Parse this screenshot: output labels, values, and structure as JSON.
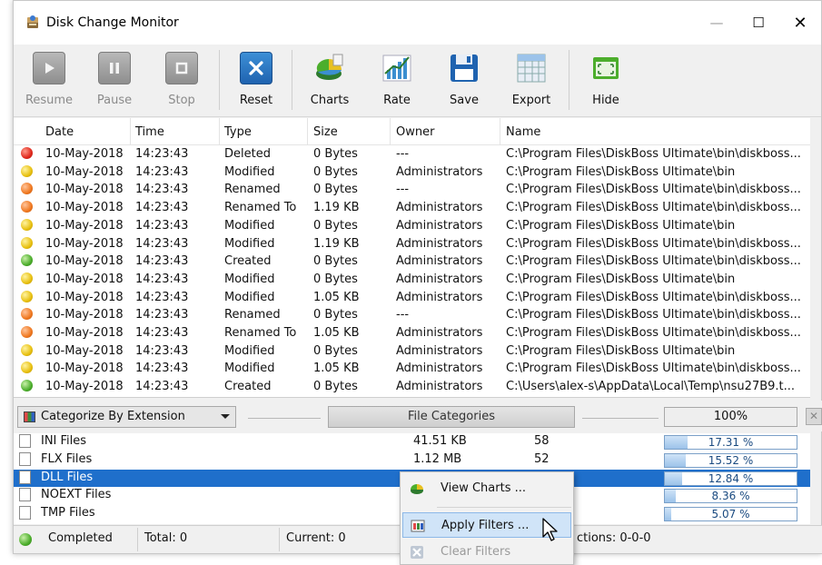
{
  "window": {
    "title": "Disk Change Monitor",
    "controls": {
      "minimize": "—",
      "maximize": "☐",
      "close": "✕"
    }
  },
  "toolbar": {
    "buttons": [
      {
        "label": "Resume",
        "icon": "play-icon",
        "enabled": false
      },
      {
        "label": "Pause",
        "icon": "pause-icon",
        "enabled": false
      },
      {
        "label": "Stop",
        "icon": "stop-icon",
        "enabled": false
      },
      {
        "label": "Reset",
        "icon": "reset-x-icon",
        "enabled": true
      },
      {
        "label": "Charts",
        "icon": "pie-chart-icon",
        "enabled": true
      },
      {
        "label": "Rate",
        "icon": "bar-chart-icon",
        "enabled": true
      },
      {
        "label": "Save",
        "icon": "floppy-disk-icon",
        "enabled": true
      },
      {
        "label": "Export",
        "icon": "spreadsheet-icon",
        "enabled": true
      },
      {
        "label": "Hide",
        "icon": "hide-window-icon",
        "enabled": true
      }
    ]
  },
  "events": {
    "columns": [
      "Date",
      "Time",
      "Type",
      "Size",
      "Owner",
      "Name"
    ],
    "rows": [
      {
        "status": "red",
        "date": "10-May-2018",
        "time": "14:23:43",
        "type": "Deleted",
        "size": "0 Bytes",
        "owner": "---",
        "name": "C:\\Program Files\\DiskBoss Ultimate\\bin\\diskboss..."
      },
      {
        "status": "yellow",
        "date": "10-May-2018",
        "time": "14:23:43",
        "type": "Modified",
        "size": "0 Bytes",
        "owner": "Administrators",
        "name": "C:\\Program Files\\DiskBoss Ultimate\\bin"
      },
      {
        "status": "orange",
        "date": "10-May-2018",
        "time": "14:23:43",
        "type": "Renamed",
        "size": "0 Bytes",
        "owner": "---",
        "name": "C:\\Program Files\\DiskBoss Ultimate\\bin\\diskboss..."
      },
      {
        "status": "orange",
        "date": "10-May-2018",
        "time": "14:23:43",
        "type": "Renamed To",
        "size": "1.19 KB",
        "owner": "Administrators",
        "name": "C:\\Program Files\\DiskBoss Ultimate\\bin\\diskboss..."
      },
      {
        "status": "yellow",
        "date": "10-May-2018",
        "time": "14:23:43",
        "type": "Modified",
        "size": "0 Bytes",
        "owner": "Administrators",
        "name": "C:\\Program Files\\DiskBoss Ultimate\\bin"
      },
      {
        "status": "yellow",
        "date": "10-May-2018",
        "time": "14:23:43",
        "type": "Modified",
        "size": "1.19 KB",
        "owner": "Administrators",
        "name": "C:\\Program Files\\DiskBoss Ultimate\\bin\\diskboss..."
      },
      {
        "status": "green",
        "date": "10-May-2018",
        "time": "14:23:43",
        "type": "Created",
        "size": "0 Bytes",
        "owner": "Administrators",
        "name": "C:\\Program Files\\DiskBoss Ultimate\\bin\\diskboss..."
      },
      {
        "status": "yellow",
        "date": "10-May-2018",
        "time": "14:23:43",
        "type": "Modified",
        "size": "0 Bytes",
        "owner": "Administrators",
        "name": "C:\\Program Files\\DiskBoss Ultimate\\bin"
      },
      {
        "status": "yellow",
        "date": "10-May-2018",
        "time": "14:23:43",
        "type": "Modified",
        "size": "1.05 KB",
        "owner": "Administrators",
        "name": "C:\\Program Files\\DiskBoss Ultimate\\bin\\diskboss..."
      },
      {
        "status": "orange",
        "date": "10-May-2018",
        "time": "14:23:43",
        "type": "Renamed",
        "size": "0 Bytes",
        "owner": "---",
        "name": "C:\\Program Files\\DiskBoss Ultimate\\bin\\diskboss..."
      },
      {
        "status": "orange",
        "date": "10-May-2018",
        "time": "14:23:43",
        "type": "Renamed To",
        "size": "1.05 KB",
        "owner": "Administrators",
        "name": "C:\\Program Files\\DiskBoss Ultimate\\bin\\diskboss..."
      },
      {
        "status": "yellow",
        "date": "10-May-2018",
        "time": "14:23:43",
        "type": "Modified",
        "size": "0 Bytes",
        "owner": "Administrators",
        "name": "C:\\Program Files\\DiskBoss Ultimate\\bin"
      },
      {
        "status": "yellow",
        "date": "10-May-2018",
        "time": "14:23:43",
        "type": "Modified",
        "size": "1.05 KB",
        "owner": "Administrators",
        "name": "C:\\Program Files\\DiskBoss Ultimate\\bin\\diskboss..."
      },
      {
        "status": "green",
        "date": "10-May-2018",
        "time": "14:23:43",
        "type": "Created",
        "size": "0 Bytes",
        "owner": "Administrators",
        "name": "C:\\Users\\alex-s\\AppData\\Local\\Temp\\nsu27B9.t..."
      }
    ]
  },
  "category_bar": {
    "selected": "Categorize By Extension",
    "file_categories_label": "File Categories",
    "percent_header": "100%",
    "close": "✕"
  },
  "categories": [
    {
      "name": "INI Files",
      "size": "41.51 KB",
      "count": "58",
      "percent": "17.31 %",
      "fraction": 0.1731,
      "selected": false
    },
    {
      "name": "FLX Files",
      "size": "1.12 MB",
      "count": "52",
      "percent": "15.52 %",
      "fraction": 0.1552,
      "selected": false
    },
    {
      "name": "DLL Files",
      "size": "",
      "count": "",
      "percent": "12.84 %",
      "fraction": 0.1284,
      "selected": true
    },
    {
      "name": "NOEXT Files",
      "size": "",
      "count": "",
      "percent": "8.36 %",
      "fraction": 0.0836,
      "selected": false
    },
    {
      "name": "TMP Files",
      "size": "",
      "count": "",
      "percent": "5.07 %",
      "fraction": 0.0507,
      "selected": false
    }
  ],
  "status": {
    "state": "Completed",
    "total": "Total: 0",
    "current": "Current: 0",
    "actions": "ctions: 0-0-0"
  },
  "context_menu": {
    "items": [
      {
        "label": "View Charts ...",
        "icon": "pie-chart-icon",
        "enabled": true,
        "hover": false
      },
      {
        "label": "Apply Filters ...",
        "icon": "filter-grid-icon",
        "enabled": true,
        "hover": true
      },
      {
        "label": "Clear Filters",
        "icon": "clear-x-icon",
        "enabled": false,
        "hover": false
      }
    ]
  },
  "colors": {
    "selection": "#1f6fcb",
    "accent": "#1f63b0"
  }
}
